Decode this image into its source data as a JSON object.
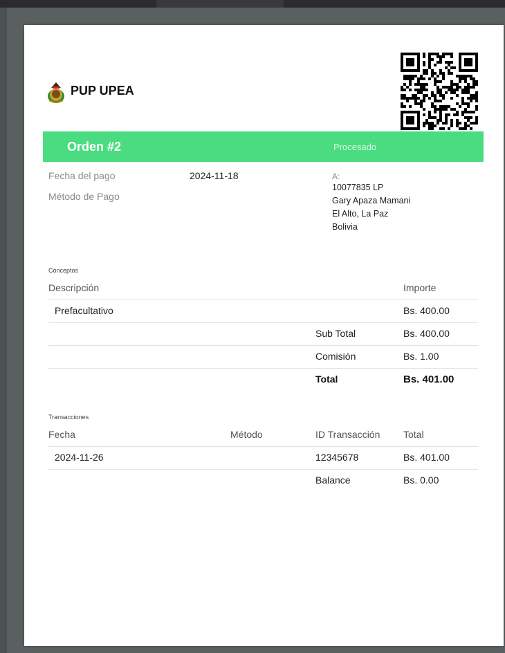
{
  "brand": {
    "name": "PUP UPEA",
    "logo_icon": "coat-of-arms-icon",
    "qr_icon": "qr-code-icon"
  },
  "banner": {
    "order_title": "Orden #2",
    "status": "Procesado",
    "color": "#4bdc82"
  },
  "details": {
    "date_label": "Fecha del pago",
    "date_value": "2024-11-18",
    "method_label": "Método de Pago",
    "to_label": "A:",
    "address": [
      "10077835 LP",
      "Gary Apaza Mamani",
      "El Alto, La Paz",
      "Bolivia"
    ]
  },
  "concepts": {
    "section_title": "Conceptos",
    "headers": {
      "description": "Descripción",
      "amount": "Importe"
    },
    "items": [
      {
        "description": "Prefacultativo",
        "amount": "Bs. 400.00"
      }
    ],
    "subtotal_label": "Sub Total",
    "subtotal_value": "Bs. 400.00",
    "commission_label": "Comisión",
    "commission_value": "Bs. 1.00",
    "total_label": "Total",
    "total_value": "Bs. 401.00"
  },
  "transactions": {
    "section_title": "Transacciones",
    "headers": {
      "date": "Fecha",
      "method": "Método",
      "id": "ID Transacción",
      "total": "Total"
    },
    "rows": [
      {
        "date": "2024-11-26",
        "method": "",
        "id": "12345678",
        "total": "Bs. 401.00"
      }
    ],
    "balance_label": "Balance",
    "balance_value": "Bs. 0.00"
  }
}
